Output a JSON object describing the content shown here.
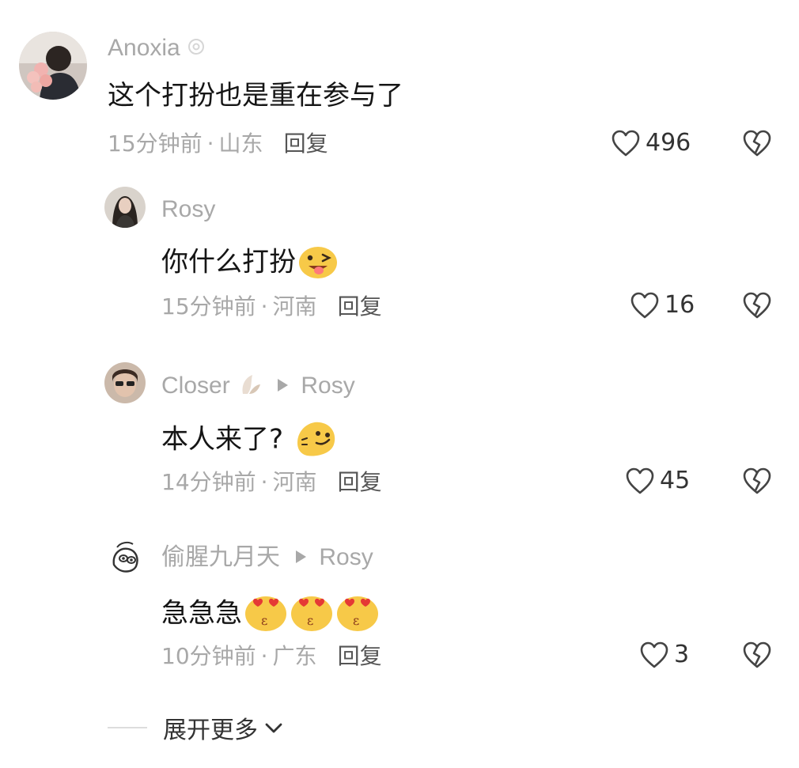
{
  "comments": [
    {
      "username": "Anoxia",
      "text": "这个打扮也是重在参与了",
      "time": "15分钟前",
      "dot": "·",
      "location": "山东",
      "reply_label": "回复",
      "likes": "496"
    },
    {
      "username": "Rosy",
      "text": "你什么打扮",
      "time": "15分钟前",
      "dot": "·",
      "location": "河南",
      "reply_label": "回复",
      "likes": "16"
    },
    {
      "username": "Closer",
      "reply_to": "Rosy",
      "text": "本人来了?",
      "time": "14分钟前",
      "dot": "·",
      "location": "河南",
      "reply_label": "回复",
      "likes": "45"
    },
    {
      "username": "偷腥九月天",
      "reply_to": "Rosy",
      "text": "急急急",
      "time": "10分钟前",
      "dot": "·",
      "location": "广东",
      "reply_label": "回复",
      "likes": "3"
    }
  ],
  "expand_label": "展开更多",
  "icons": {
    "like": "heart-outline-icon",
    "dislike": "broken-heart-icon",
    "expand": "chevron-down-icon"
  },
  "colors": {
    "secondary_text": "#a8a8a8",
    "primary_text": "#151515",
    "emoji_yellow": "#f7c948"
  }
}
